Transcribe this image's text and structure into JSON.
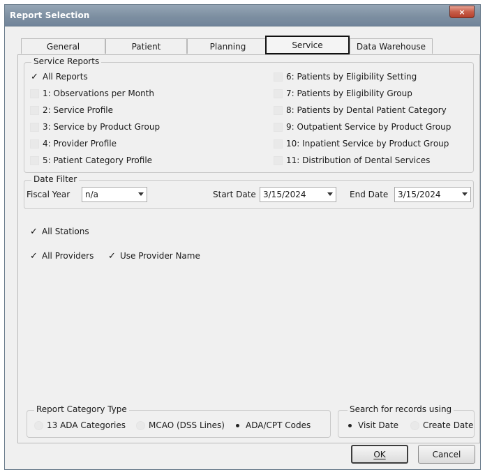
{
  "window": {
    "title": "Report Selection",
    "close_glyph": "×"
  },
  "tabs": [
    {
      "label": "General"
    },
    {
      "label": "Patient"
    },
    {
      "label": "Planning"
    },
    {
      "label": "Service"
    },
    {
      "label": "Data Warehouse"
    }
  ],
  "service_reports": {
    "legend": "Service Reports",
    "left": [
      {
        "label": "All Reports",
        "checked": true
      },
      {
        "label": "1: Observations per Month",
        "checked": false
      },
      {
        "label": "2: Service Profile",
        "checked": false
      },
      {
        "label": "3: Service by Product Group",
        "checked": false
      },
      {
        "label": "4: Provider Profile",
        "checked": false
      },
      {
        "label": "5: Patient Category Profile",
        "checked": false
      }
    ],
    "right": [
      {
        "label": "6: Patients by Eligibility Setting",
        "checked": false
      },
      {
        "label": "7: Patients by Eligibility Group",
        "checked": false
      },
      {
        "label": "8: Patients by Dental Patient Category",
        "checked": false
      },
      {
        "label": "9: Outpatient Service by Product Group",
        "checked": false
      },
      {
        "label": "10: Inpatient Service by Product Group",
        "checked": false
      },
      {
        "label": "11: Distribution of Dental Services",
        "checked": false
      }
    ]
  },
  "date_filter": {
    "legend": "Date Filter",
    "fiscal_year_label": "Fiscal Year",
    "fiscal_year_value": "n/a",
    "start_label": "Start Date",
    "start_value": "3/15/2024",
    "end_label": "End Date",
    "end_value": "3/15/2024"
  },
  "options": {
    "all_stations": "All Stations",
    "all_providers": "All Providers",
    "use_provider_name": "Use Provider Name",
    "check_glyph": "✓"
  },
  "report_category": {
    "legend": "Report Category Type",
    "options": [
      {
        "label": "13 ADA Categories",
        "selected": false
      },
      {
        "label": "MCAO (DSS Lines)",
        "selected": false
      },
      {
        "label": "ADA/CPT Codes",
        "selected": true
      }
    ]
  },
  "search_records": {
    "legend": "Search for records using",
    "options": [
      {
        "label": "Visit Date",
        "selected": true
      },
      {
        "label": "Create Date",
        "selected": false
      }
    ]
  },
  "buttons": {
    "ok": "OK",
    "cancel": "Cancel"
  }
}
